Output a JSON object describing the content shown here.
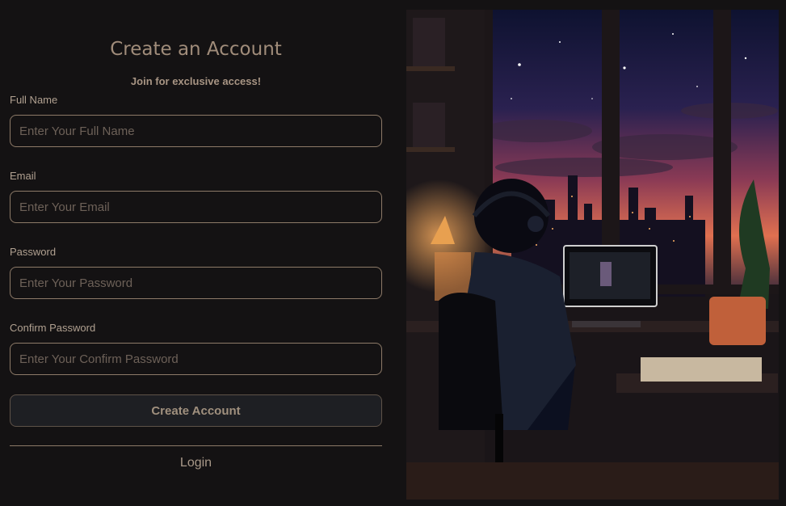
{
  "form": {
    "title": "Create an Account",
    "subtitle": "Join for exclusive access!",
    "fields": [
      {
        "label": "Full Name",
        "placeholder": "Enter Your Full Name"
      },
      {
        "label": "Email",
        "placeholder": "Enter Your Email"
      },
      {
        "label": "Password",
        "placeholder": "Enter Your Password"
      },
      {
        "label": "Confirm Password",
        "placeholder": "Enter Your Confirm Password"
      }
    ],
    "submit_label": "Create Account",
    "login_label": "Login"
  },
  "colors": {
    "background": "#141213",
    "accent_text": "#a08c7a",
    "input_border": "#8d7a68",
    "button_bg": "#1e1f23"
  }
}
